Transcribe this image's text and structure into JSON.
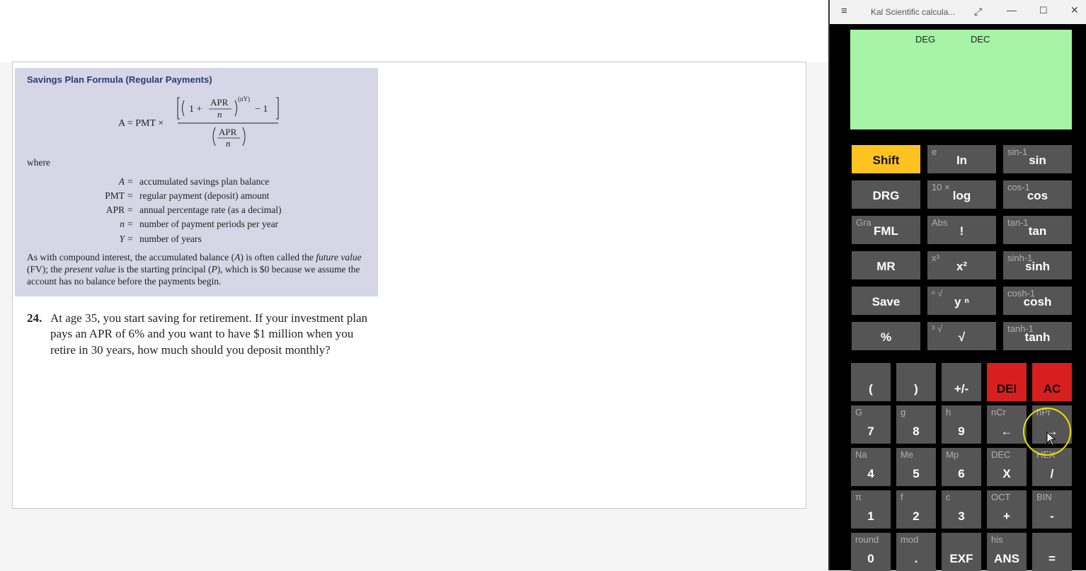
{
  "document": {
    "formula_title": "Savings Plan Formula (Regular Payments)",
    "eq_lhs": "A = PMT ×",
    "eq_one": "1 +",
    "eq_apr": "APR",
    "eq_n": "n",
    "eq_exp": "(nY)",
    "eq_minus": "− 1",
    "where": "where",
    "definitions": [
      {
        "sym": "A",
        "desc": "accumulated savings plan balance"
      },
      {
        "sym": "PMT",
        "desc": "regular payment (deposit) amount"
      },
      {
        "sym": "APR",
        "desc": "annual percentage rate (as a decimal)"
      },
      {
        "sym": "n",
        "desc": "number of payment periods per year"
      },
      {
        "sym": "Y",
        "desc": "number of years"
      }
    ],
    "note_1": "As with compound interest, the accumulated balance (",
    "note_A": "A",
    "note_2": ") is often called the ",
    "note_future": "future value",
    "note_3": " (FV); the ",
    "note_present": "present value",
    "note_4": " is the starting principal (",
    "note_P": "P",
    "note_5": "), which is $0 because we assume the account has no balance before the payments begin.",
    "problem_number": "24.",
    "problem_text": "At age 35, you start saving for retirement. If your investment plan pays an APR of 6% and you want to have $1 million when you retire in 30 years, how much should you deposit monthly?"
  },
  "calculator": {
    "title": "Kal Scientific calcula...",
    "icons": {
      "menu": "hamburger-icon",
      "expand": "expand-icon",
      "minimize": "minimize-icon",
      "maximize": "maximize-icon",
      "close": "close-icon"
    },
    "display": {
      "angle_mode": "DEG",
      "number_mode": "DEC",
      "value": ""
    },
    "colors": {
      "display_bg": "#a6f4a6",
      "shift": "#ffc21f",
      "danger": "#d71f1f",
      "button": "#555555"
    },
    "upper_rows": [
      [
        {
          "main": "Shift",
          "sec": ""
        },
        {
          "main": "In",
          "sec": "e"
        },
        {
          "main": "sin",
          "sec": "sin-1"
        }
      ],
      [
        {
          "main": "DRG",
          "sec": ""
        },
        {
          "main": "log",
          "sec": "10 ×"
        },
        {
          "main": "cos",
          "sec": "cos-1"
        }
      ],
      [
        {
          "main": "FML",
          "sec": "Gra"
        },
        {
          "main": "!",
          "sec": "Abs"
        },
        {
          "main": "tan",
          "sec": "tan-1"
        }
      ],
      [
        {
          "main": "MR",
          "sec": ""
        },
        {
          "main": "x²",
          "sec": "x³"
        },
        {
          "main": "sinh",
          "sec": "sinh-1"
        }
      ],
      [
        {
          "main": "Save",
          "sec": ""
        },
        {
          "main": "y ⁿ",
          "sec": "ⁿ √"
        },
        {
          "main": "cosh",
          "sec": "cosh-1"
        }
      ],
      [
        {
          "main": "%",
          "sec": ""
        },
        {
          "main": "√",
          "sec": "³ √"
        },
        {
          "main": "tanh",
          "sec": "tanh-1"
        }
      ]
    ],
    "lower_rows": [
      [
        {
          "main": "(",
          "sec": ""
        },
        {
          "main": ")",
          "sec": ""
        },
        {
          "main": "+/-",
          "sec": ""
        },
        {
          "main": "DEI",
          "sec": ""
        },
        {
          "main": "AC",
          "sec": ""
        }
      ],
      [
        {
          "main": "7",
          "sec": "G"
        },
        {
          "main": "8",
          "sec": "g"
        },
        {
          "main": "9",
          "sec": "h"
        },
        {
          "main": "←",
          "sec": "nCr"
        },
        {
          "main": "→",
          "sec": "nPr"
        }
      ],
      [
        {
          "main": "4",
          "sec": "Na"
        },
        {
          "main": "5",
          "sec": "Me"
        },
        {
          "main": "6",
          "sec": "Mp"
        },
        {
          "main": "X",
          "sec": "DEC"
        },
        {
          "main": "/",
          "sec": "HEX"
        }
      ],
      [
        {
          "main": "1",
          "sec": "π"
        },
        {
          "main": "2",
          "sec": "f"
        },
        {
          "main": "3",
          "sec": "c"
        },
        {
          "main": "+",
          "sec": "OCT"
        },
        {
          "main": "-",
          "sec": "BIN"
        }
      ],
      [
        {
          "main": "0",
          "sec": "round"
        },
        {
          "main": ".",
          "sec": "mod"
        },
        {
          "main": "EXF",
          "sec": ""
        },
        {
          "main": "ANS",
          "sec": "his"
        },
        {
          "main": "=",
          "sec": ""
        }
      ]
    ]
  }
}
